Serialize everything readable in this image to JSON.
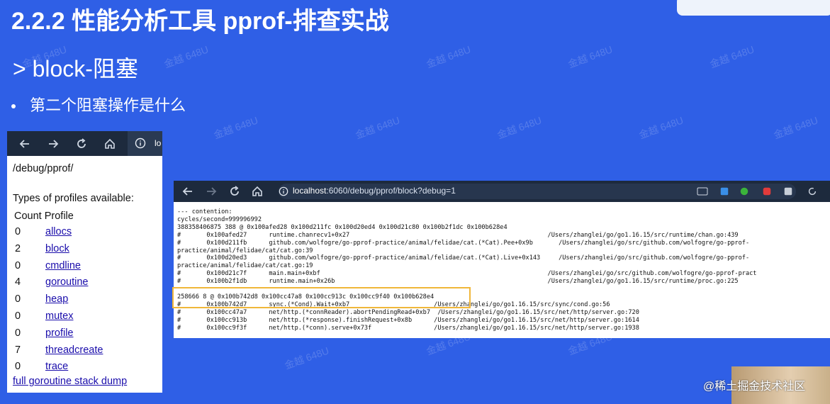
{
  "slide": {
    "title": "2.2.2 性能分析工具 pprof-排查实战",
    "subtitle": "> block-阻塞",
    "bullet": "第二个阻塞操作是什么",
    "watermark": "金越 648U",
    "credit": "@稀土掘金技术社区"
  },
  "left_browser": {
    "address_fragment": "lo",
    "path": "/debug/pprof/",
    "types_heading": "Types of profiles available:",
    "col_count": "Count",
    "col_profile": "Profile",
    "profiles": [
      {
        "count": "0",
        "name": "allocs"
      },
      {
        "count": "2",
        "name": "block"
      },
      {
        "count": "0",
        "name": "cmdline"
      },
      {
        "count": "4",
        "name": "goroutine"
      },
      {
        "count": "0",
        "name": "heap"
      },
      {
        "count": "0",
        "name": "mutex"
      },
      {
        "count": "0",
        "name": "profile"
      },
      {
        "count": "7",
        "name": "threadcreate"
      },
      {
        "count": "0",
        "name": "trace"
      }
    ],
    "dump_link": "full goroutine stack dump"
  },
  "right_browser": {
    "url_host": "localhost",
    "url_rest": ":6060/debug/pprof/block?debug=1",
    "lines": [
      "--- contention:",
      "cycles/second=999996992",
      "388358406875 388 @ 0x100afed28 0x100d211fc 0x100d20ed4 0x100d21c80 0x100b2f1dc 0x100b628e4",
      "#       0x100afed27      runtime.chanrecv1+0x27                                                      /Users/zhanglei/go/go1.16.15/src/runtime/chan.go:439",
      "#       0x100d211fb      github.com/wolfogre/go-pprof-practice/animal/felidae/cat.(*Cat).Pee+0x9b       /Users/zhanglei/go/src/github.com/wolfogre/go-pprof-",
      "practice/animal/felidae/cat/cat.go:39",
      "#       0x100d20ed3      github.com/wolfogre/go-pprof-practice/animal/felidae/cat.(*Cat).Live+0x143     /Users/zhanglei/go/src/github.com/wolfogre/go-pprof-",
      "practice/animal/felidae/cat/cat.go:19",
      "#       0x100d21c7f      main.main+0xbf                                                              /Users/zhanglei/go/src/github.com/wolfogre/go-pprof-pract",
      "#       0x100b2f1db      runtime.main+0x26b                                                          /Users/zhanglei/go/go1.16.15/src/runtime/proc.go:225",
      "",
      "258666 8 @ 0x100b742d8 0x100cc47a8 0x100cc913c 0x100cc9f40 0x100b628e4",
      "#       0x100b742d7      sync.(*Cond).Wait+0xb7                       /Users/zhanglei/go/go1.16.15/src/sync/cond.go:56",
      "#       0x100cc47a7      net/http.(*connReader).abortPendingRead+0xb7  /Users/zhanglei/go/go1.16.15/src/net/http/server.go:720",
      "#       0x100cc913b      net/http.(*response).finishRequest+0x8b      /Users/zhanglei/go/go1.16.15/src/net/http/server.go:1614",
      "#       0x100cc9f3f      net/http.(*conn).serve+0x73f                 /Users/zhanglei/go/go1.16.15/src/net/http/server.go:1938"
    ]
  },
  "colors": {
    "slide_bg": "#2f5fe6",
    "browser_bar": "#1d2a3d",
    "link": "#1a0dab",
    "highlight": "#f0b73a"
  }
}
